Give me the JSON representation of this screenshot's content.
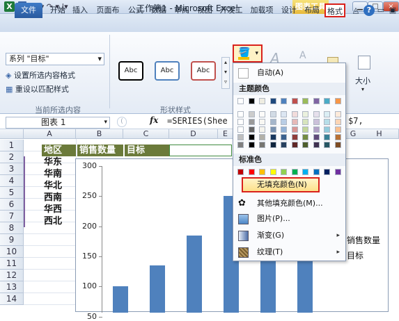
{
  "window": {
    "title": "工作簿1 - Microsoft Excel",
    "chart_tools": "图表工具",
    "qat": "↶ ▾ ↷ ▾ |▾"
  },
  "tabs": [
    "文件",
    "开始",
    "插入",
    "页面布",
    "公式",
    "数据",
    "审阅",
    "视图",
    "开发工",
    "加载项",
    "设计",
    "布局",
    "格式"
  ],
  "ribbon": {
    "series_selector": "系列 \"目标\"",
    "format_selection": "设置所选内容格式",
    "reset_style": "重设以匹配样式",
    "group_current": "当前所选内容",
    "group_shape_styles": "形状样式",
    "shape_style_labels": [
      "Abc",
      "Abc",
      "Abc"
    ],
    "size_label": "大小",
    "font_a": "A",
    "colors": {
      "style1": "#000000",
      "style2": "#4f81bd",
      "style3": "#c0504d",
      "highlight": "#d9211c"
    }
  },
  "formula_bar": {
    "name_box": "图表 1",
    "fx": "fx",
    "formula": "=SERIES(Shee",
    "formula_tail": "$7,"
  },
  "sheet": {
    "columns": [
      "A",
      "B",
      "C",
      "D",
      "E",
      "F",
      "G",
      "H"
    ],
    "rows": [
      "1",
      "2",
      "3",
      "4",
      "5",
      "6",
      "7",
      "8",
      "9",
      "10",
      "11",
      "12",
      "13",
      "14"
    ],
    "headers": [
      "地区",
      "销售数量",
      "目标"
    ],
    "regions": [
      "华东",
      "华南",
      "华北",
      "西南",
      "华西",
      "西北"
    ]
  },
  "chart_data": {
    "type": "bar",
    "categories": [
      "华东",
      "华南",
      "华北",
      "西南",
      "华西",
      "西北"
    ],
    "series": [
      {
        "name": "销售数量",
        "values": [
          100,
          135,
          185,
          250,
          240,
          155
        ]
      }
    ],
    "yticks": [
      "300",
      "250",
      "200",
      "150",
      "100",
      "50"
    ],
    "ylim": [
      0,
      300
    ],
    "legend": [
      "销售数量",
      "目标"
    ],
    "bar_color": "#4f81bd"
  },
  "fill_menu": {
    "auto": "自动(A)",
    "theme_colors": "主题颜色",
    "standard_colors": "标准色",
    "no_fill": "无填充颜色(N)",
    "more_colors": "其他填充颜色(M)...",
    "picture": "图片(P)...",
    "gradient": "渐变(G)",
    "texture": "纹理(T)",
    "theme_top": [
      "#ffffff",
      "#000000",
      "#eeece1",
      "#1f497d",
      "#4f81bd",
      "#c0504d",
      "#9bbb59",
      "#8064a2",
      "#4bacc6",
      "#f79646"
    ],
    "standard": [
      "#c00000",
      "#ff0000",
      "#ffc000",
      "#ffff00",
      "#92d050",
      "#00b050",
      "#00b0f0",
      "#0070c0",
      "#002060",
      "#7030a0"
    ]
  }
}
